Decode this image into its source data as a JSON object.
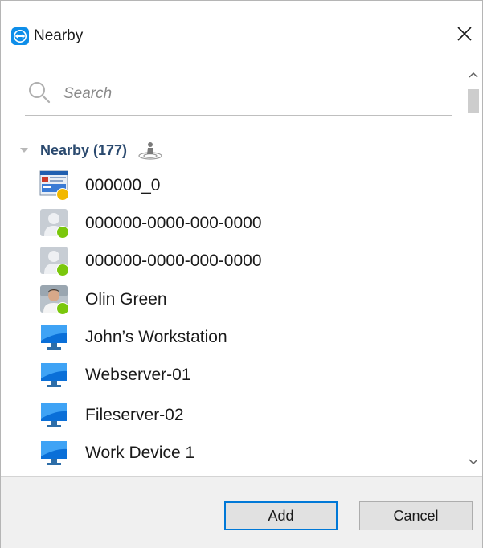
{
  "window": {
    "title": "Nearby"
  },
  "search": {
    "placeholder": "Search",
    "value": ""
  },
  "group": {
    "label": "Nearby (177)",
    "expanded": true
  },
  "items": [
    {
      "label": "000000_0",
      "icon": "computer-screenshot-icon",
      "status": "away",
      "status_color": "#f2b800"
    },
    {
      "label": "000000-0000-000-0000",
      "icon": "contact-placeholder-icon",
      "status": "online",
      "status_color": "#7ac70c"
    },
    {
      "label": "000000-0000-000-0000",
      "icon": "contact-placeholder-icon",
      "status": "online",
      "status_color": "#7ac70c"
    },
    {
      "label": "Olin Green",
      "icon": "contact-photo-icon",
      "status": "online",
      "status_color": "#7ac70c"
    },
    {
      "label": "John’s Workstation",
      "icon": "monitor-icon"
    },
    {
      "label": "Webserver-01",
      "icon": "monitor-icon"
    },
    {
      "label": "Fileserver-02",
      "icon": "monitor-icon"
    },
    {
      "label": "Work Device 1",
      "icon": "monitor-icon"
    }
  ],
  "buttons": {
    "add": "Add",
    "cancel": "Cancel"
  },
  "colors": {
    "accent": "#0078d7",
    "group_text": "#2b4a6f",
    "online": "#7ac70c",
    "away": "#f2b800"
  }
}
